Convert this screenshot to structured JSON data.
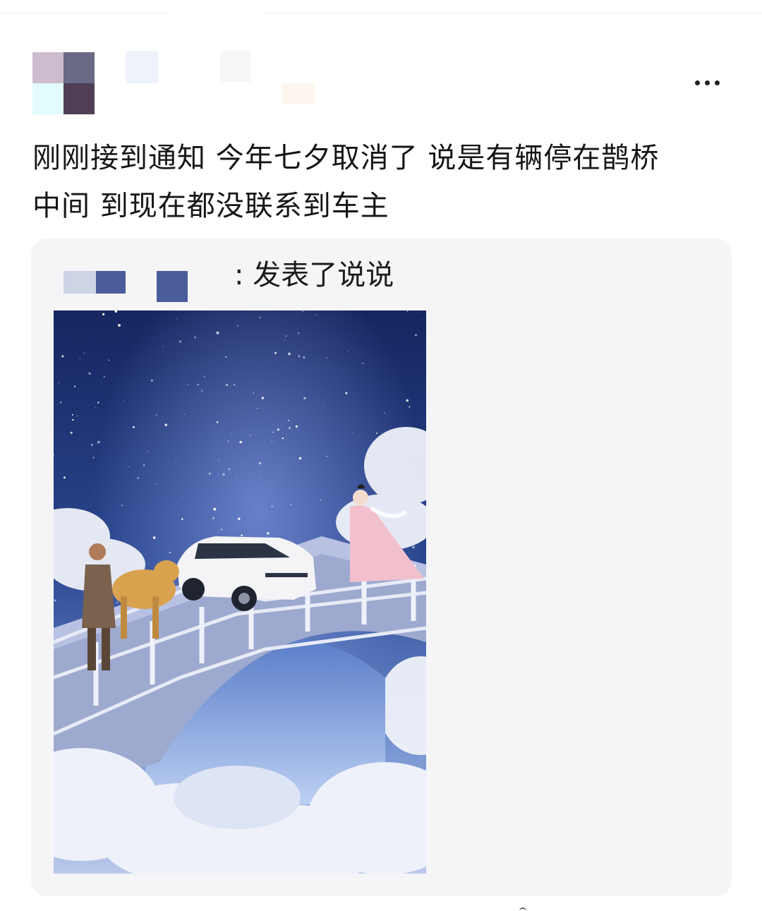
{
  "post": {
    "text_line_1": "刚刚接到通知 今年七夕取消了 说是有辆停在鹊桥",
    "text_line_2": "中间 到现在都没联系到车主"
  },
  "avatar": {
    "mosaic_colors": [
      "#cdbccd",
      "#6b6a86",
      "#e2fbfb",
      "#4f3e55"
    ]
  },
  "more_menu": {
    "icon": "more-horizontal-icon"
  },
  "shared_post": {
    "action_text": ": 发表了说说",
    "image": {
      "subject": "stars-bridge-car-scene",
      "colors": {
        "sky_top": "#1a2a68",
        "sky_mid": "#3a5fae",
        "cloud": "#e8ecf6",
        "bridge": "#c9d1ea",
        "car": "#f4f4f6",
        "robe": "#f2c0cc"
      }
    }
  }
}
